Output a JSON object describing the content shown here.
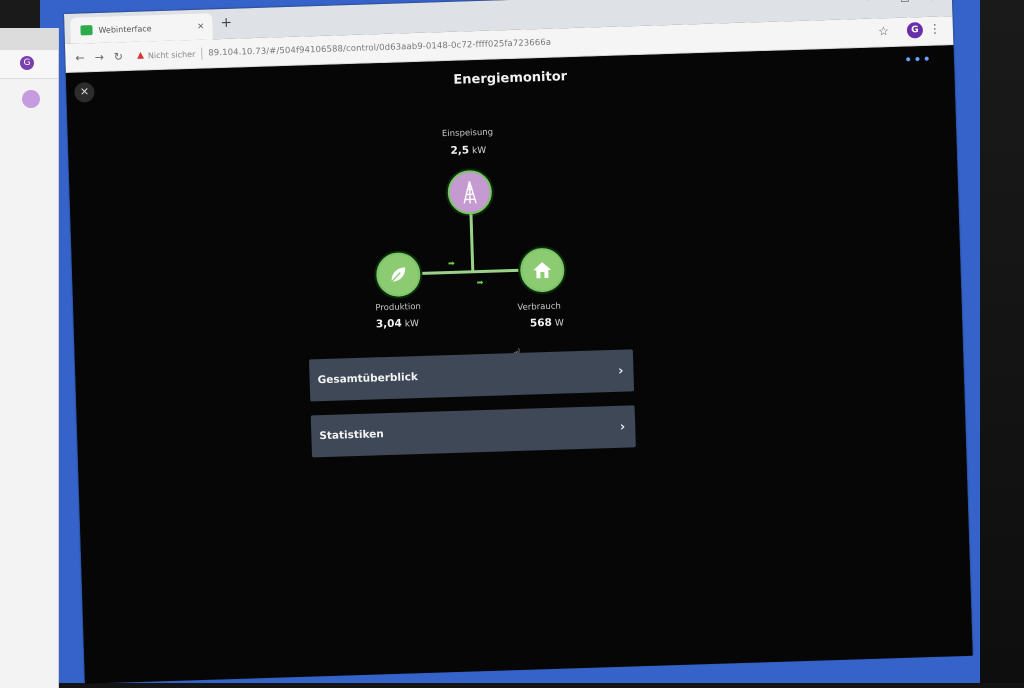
{
  "background_window": {
    "avatar_letter": "G"
  },
  "browser": {
    "tab": {
      "title": "Webinterface",
      "close_glyph": "×"
    },
    "new_tab_glyph": "+",
    "window_controls": {
      "minimize": "—",
      "maximize": "☐",
      "close": "×"
    },
    "toolbar": {
      "back": "←",
      "forward": "→",
      "reload": "↻",
      "security_icon": "warning-triangle-icon",
      "security_text": "Nicht sicher",
      "url": "89.104.10.73/#/504f94106588/control/0d63aab9-0148-0c72-ffff025fa723666a",
      "avatar_letter": "G",
      "star_glyph": "☆",
      "menu_glyph": "⋮"
    }
  },
  "app": {
    "title": "Energiemonitor",
    "close_glyph": "✕",
    "more_glyph": "•••",
    "grid": {
      "label": "Einspeisung",
      "value": "2,5",
      "unit": "kW",
      "icon": "power-tower-icon"
    },
    "production": {
      "label": "Produktion",
      "value": "3,04",
      "unit": "kW",
      "icon": "leaf-icon"
    },
    "consumption": {
      "label": "Verbrauch",
      "value": "568",
      "unit": "W",
      "icon": "house-icon"
    },
    "menu": [
      {
        "label": "Gesamtüberblick",
        "chevron": "›"
      },
      {
        "label": "Statistiken",
        "chevron": "›"
      }
    ]
  },
  "colors": {
    "node_green": "#8ccb72",
    "node_purple": "#c59ad0",
    "flow_line": "#9ad28a",
    "menu_row": "#3e4857",
    "page_bg": "#060606",
    "accent_blue": "#6aa3ff"
  }
}
